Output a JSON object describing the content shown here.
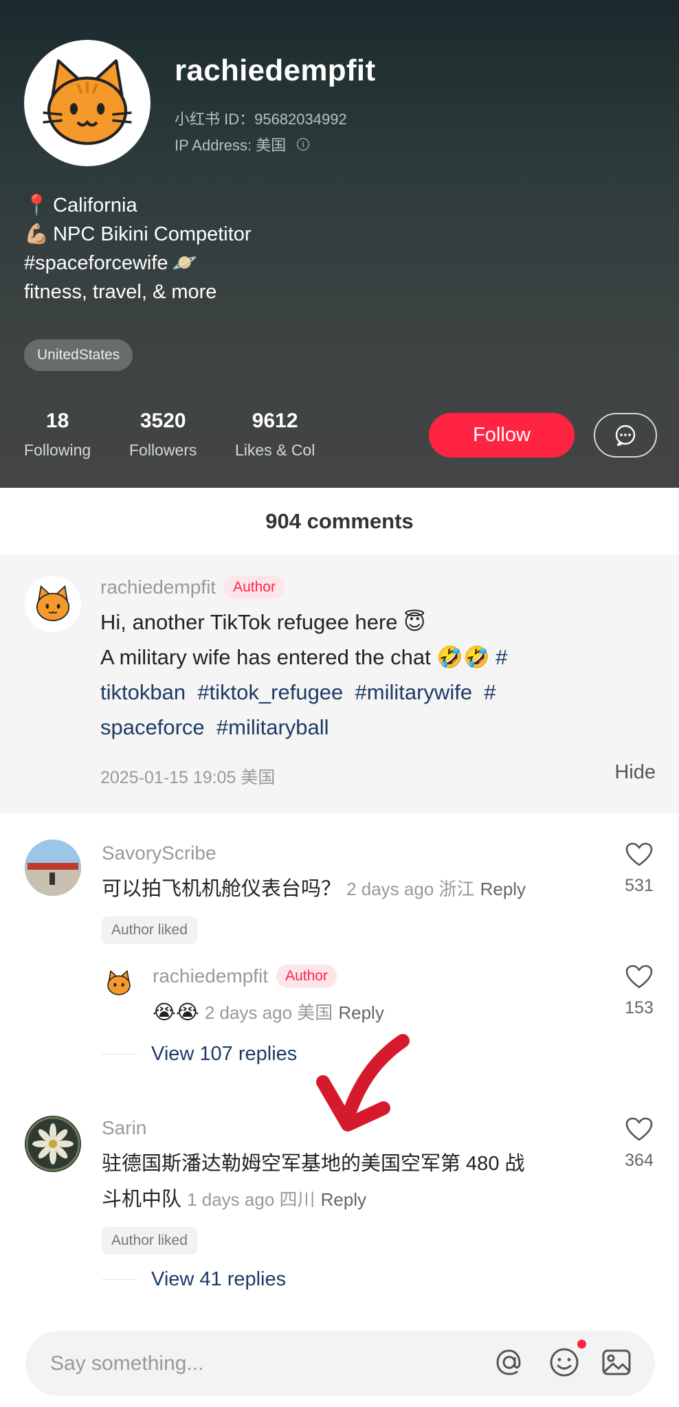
{
  "profile": {
    "username": "rachiedempfit",
    "id_line": "小红书 ID：95682034992",
    "ip_line": "IP Address: 美国",
    "bio": [
      {
        "emoji": "📍",
        "text": "California"
      },
      {
        "emoji": "💪🏼",
        "text": "NPC Bikini Competitor"
      },
      {
        "emoji": "🪐",
        "text": "#spaceforcewife"
      },
      {
        "emoji": "",
        "text": "fitness, travel, & more"
      }
    ],
    "tag": "UnitedStates",
    "stats": [
      {
        "num": "18",
        "label": "Following"
      },
      {
        "num": "3520",
        "label": "Followers"
      },
      {
        "num": "9612",
        "label": "Likes & Col"
      }
    ],
    "follow_label": "Follow"
  },
  "comments_title": "904 comments",
  "pinned": {
    "name": "rachiedempfit",
    "badge": "Author",
    "line1": "Hi, another TikTok refugee here 😇",
    "line2_plain": "A military wife has entered the chat 🤣🤣 ",
    "line2_hash": "#",
    "line3": [
      "tiktokban",
      "#tiktok_refugee",
      "#militarywife",
      "#"
    ],
    "line4": [
      "spaceforce",
      "#militaryball"
    ],
    "date": "2025-01-15 19:05 美国",
    "hide": "Hide"
  },
  "comments": [
    {
      "name": "SavoryScribe",
      "text": "可以拍飞机机舱仪表台吗？",
      "meta": "2 days ago 浙江",
      "reply": "Reply",
      "likes": "531",
      "liked": "Author liked",
      "sub": {
        "name": "rachiedempfit",
        "badge": "Author",
        "emoji": "😭😭",
        "meta": "2 days ago 美国",
        "reply": "Reply",
        "likes": "153"
      },
      "view_replies": "View 107 replies"
    },
    {
      "name": "Sarin",
      "text1": "驻德国斯潘达勒姆空军基地的美国空军第 480 战",
      "text2": "斗机中队",
      "meta": "1 days ago 四川",
      "reply": "Reply",
      "likes": "364",
      "liked": "Author liked",
      "view_replies": "View 41 replies"
    }
  ],
  "input": {
    "placeholder": "Say something..."
  },
  "colors": {
    "accent": "#ff2442",
    "hashtag": "#1d3b66",
    "header_bg": "#2e3b3b"
  }
}
